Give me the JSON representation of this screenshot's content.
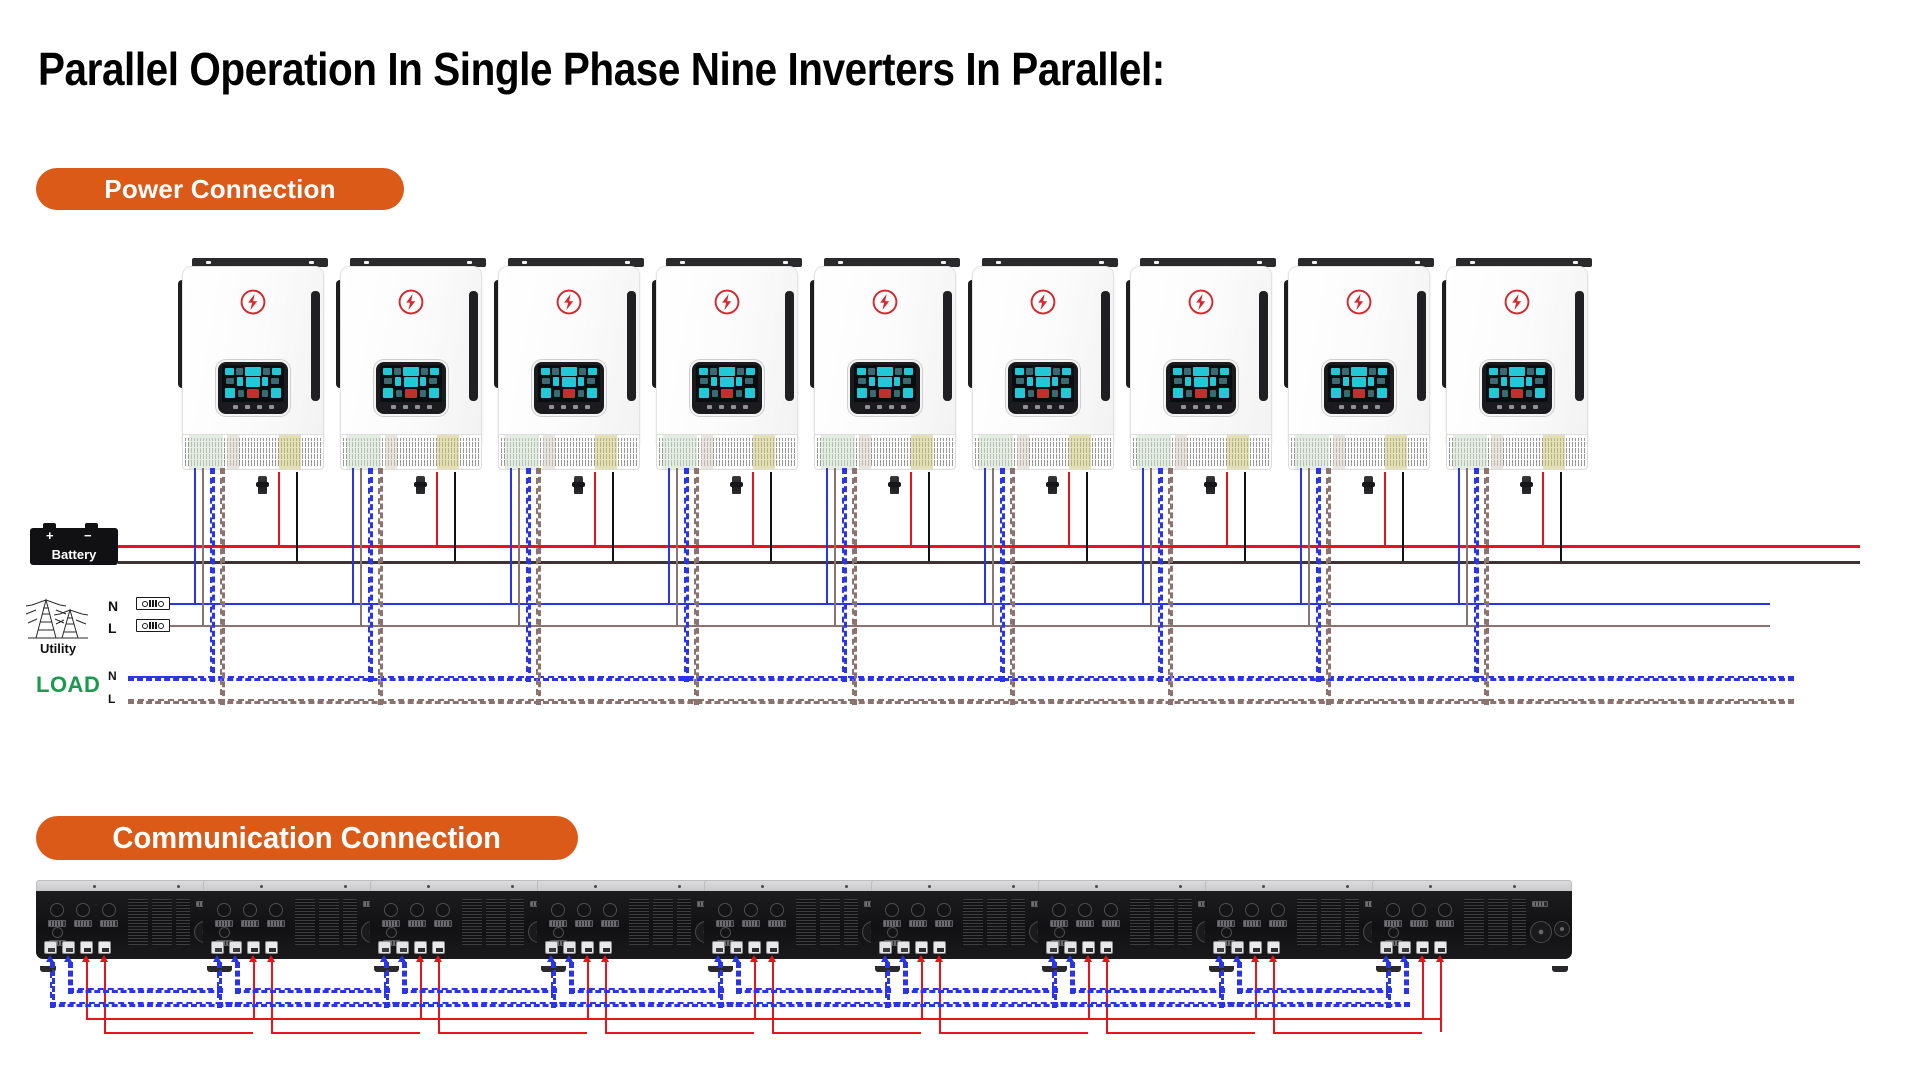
{
  "page": {
    "title": "Parallel Operation In Single Phase Nine Inverters In Parallel:",
    "background_color": "#ffffff",
    "accent_color": "#DB5A17"
  },
  "sections": [
    {
      "id": "power",
      "badge_label": "Power Connection"
    },
    {
      "id": "communication",
      "badge_label": "Communication Connection"
    }
  ],
  "power_connection": {
    "inverter_count": 9,
    "inverters": [
      {
        "index": 1,
        "logo": "lightning-bolt-icon"
      },
      {
        "index": 2,
        "logo": "lightning-bolt-icon"
      },
      {
        "index": 3,
        "logo": "lightning-bolt-icon"
      },
      {
        "index": 4,
        "logo": "lightning-bolt-icon"
      },
      {
        "index": 5,
        "logo": "lightning-bolt-icon"
      },
      {
        "index": 6,
        "logo": "lightning-bolt-icon"
      },
      {
        "index": 7,
        "logo": "lightning-bolt-icon"
      },
      {
        "index": 8,
        "logo": "lightning-bolt-icon"
      },
      {
        "index": 9,
        "logo": "lightning-bolt-icon"
      }
    ],
    "battery": {
      "label": "Battery",
      "positive_terminal": "+",
      "negative_terminal": "−",
      "positive_wire_color": "#e8131b",
      "negative_wire_color": "#3b3334"
    },
    "utility": {
      "label": "Utility",
      "icon": "power-pylon-icon",
      "lines": [
        {
          "label": "N",
          "wire_color": "#2b35e8",
          "style": "solid"
        },
        {
          "label": "L",
          "wire_color": "#8d7370",
          "style": "solid"
        }
      ]
    },
    "load": {
      "label": "LOAD",
      "label_color": "#1a9a4e",
      "lines": [
        {
          "label": "N",
          "wire_color": "#2b35e8",
          "style": "dashed"
        },
        {
          "label": "L",
          "wire_color": "#8d7370",
          "style": "dashed"
        }
      ]
    }
  },
  "communication_connection": {
    "unit_count": 9,
    "ports_per_unit": 4,
    "cable_types": [
      {
        "name": "parallel-communication-cable",
        "color": "#2b35e8",
        "style": "dashed"
      },
      {
        "name": "current-sharing-cable",
        "color": "#e8131b",
        "style": "solid"
      }
    ]
  }
}
